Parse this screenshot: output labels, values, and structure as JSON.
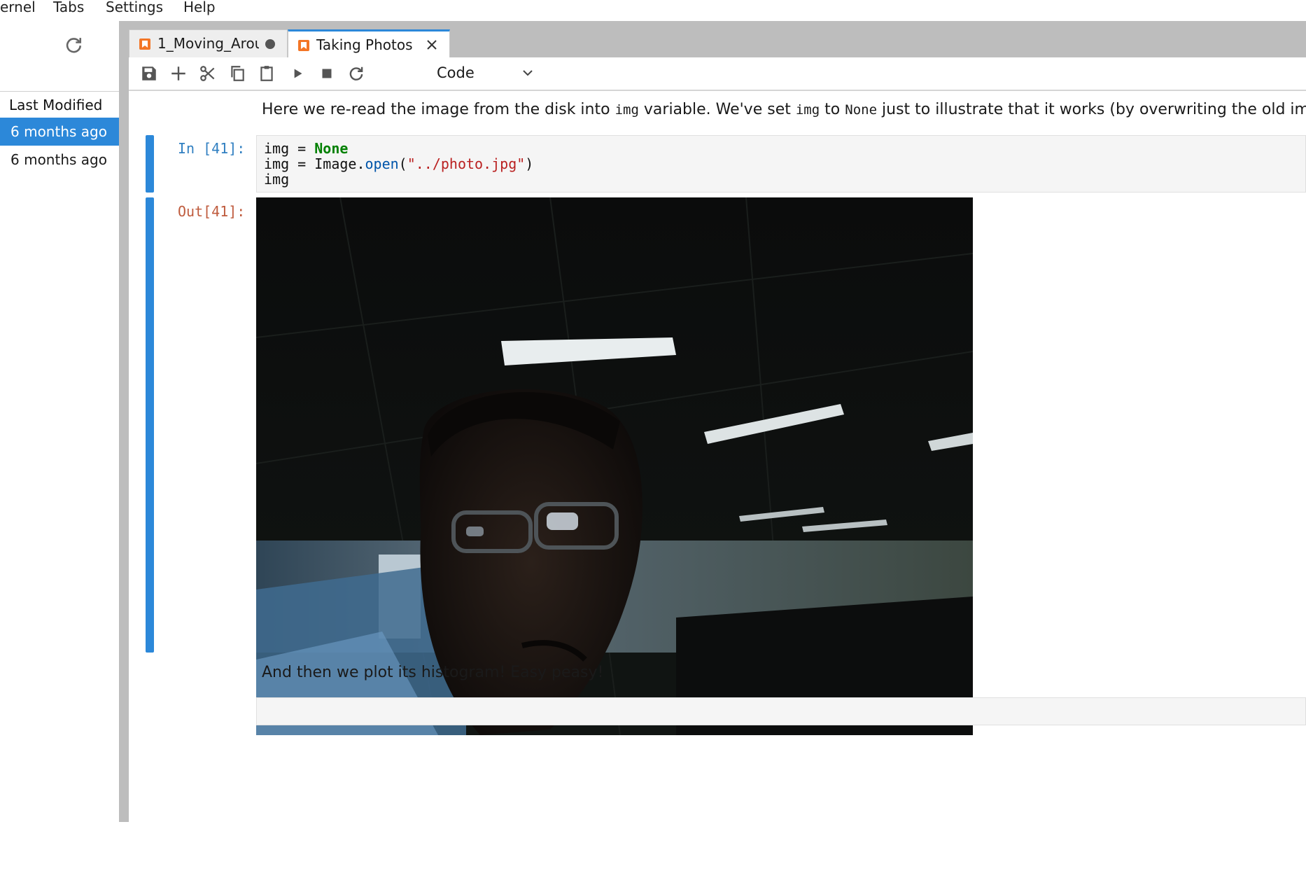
{
  "menu": {
    "items": [
      "ernel",
      "Tabs",
      "Settings",
      "Help"
    ]
  },
  "sidebar": {
    "column_header": "Last Modified",
    "rows": [
      {
        "modified": "6 months ago",
        "selected": true
      },
      {
        "modified": "6 months ago",
        "selected": false
      }
    ]
  },
  "tabs": [
    {
      "label": "1_Moving_Arou",
      "active": false,
      "unsaved": true
    },
    {
      "label": "Taking Photos",
      "active": true,
      "unsaved": false
    }
  ],
  "toolbar": {
    "cell_type": "Code",
    "icons": [
      "save-icon",
      "add-cell-icon",
      "cut-icon",
      "copy-icon",
      "paste-icon",
      "run-icon",
      "stop-icon",
      "restart-icon",
      "chevron-down-icon"
    ]
  },
  "notebook": {
    "md1": {
      "t1": "Here we re-read the image from the disk into ",
      "c1": "img",
      "t2": " variable. We've set ",
      "c2": "img",
      "t3": " to ",
      "c3": "None",
      "t4": " just to illustrate that it works (by overwriting the old image)"
    },
    "cell41": {
      "in_prompt": "In [41]:",
      "out_prompt": "Out[41]:",
      "l1_var": "img = ",
      "l1_kw": "None",
      "l2_a": "img = Image.",
      "l2_fn": "open",
      "l2_b": "(",
      "l2_str": "\"../photo.jpg\"",
      "l2_c": ")",
      "l3": "img"
    },
    "md2": "And then we plot its histogram! Easy peasy!"
  },
  "colors": {
    "accent": "#2c88d9",
    "in_prompt": "#307fc1",
    "out_prompt": "#bf5b3d",
    "notebook_icon": "#f37626"
  }
}
